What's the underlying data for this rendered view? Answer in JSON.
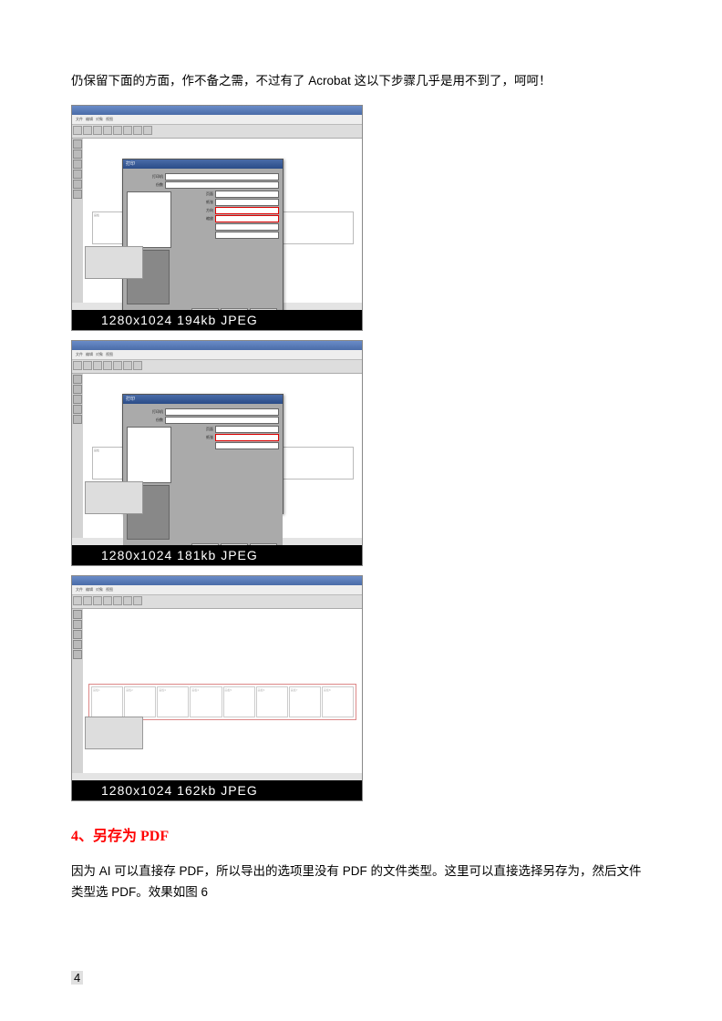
{
  "para1": "仍保留下面的方面，作不备之需，不过有了 Acrobat 这以下步骤几乎是用不到了，呵呵！",
  "shot1": {
    "caption": "1280x1024 194kb JPEG",
    "dialog_title": "打印",
    "labels": [
      "打印机",
      "份数",
      "页面",
      "纸张",
      "方向",
      "缩放"
    ],
    "artboards": [
      "画板",
      "画板"
    ]
  },
  "shot2": {
    "caption": "1280x1024 181kb JPEG",
    "dialog_title": "打印",
    "labels": [
      "打印机",
      "份数",
      "页面",
      "纸张"
    ],
    "artboards": [
      "画板",
      "画板"
    ]
  },
  "shot3": {
    "caption": "1280x1024 162kb JPEG",
    "artboards": [
      "画板1",
      "画板2",
      "画板3",
      "画板4",
      "画板5",
      "画板6",
      "画板7",
      "画板8"
    ]
  },
  "heading": "4、另存为 PDF",
  "para2": "因为 AI 可以直接存 PDF，所以导出的选项里没有 PDF 的文件类型。这里可以直接选择另存为，然后文件类型选 PDF。效果如图 6",
  "pageNum": "4"
}
